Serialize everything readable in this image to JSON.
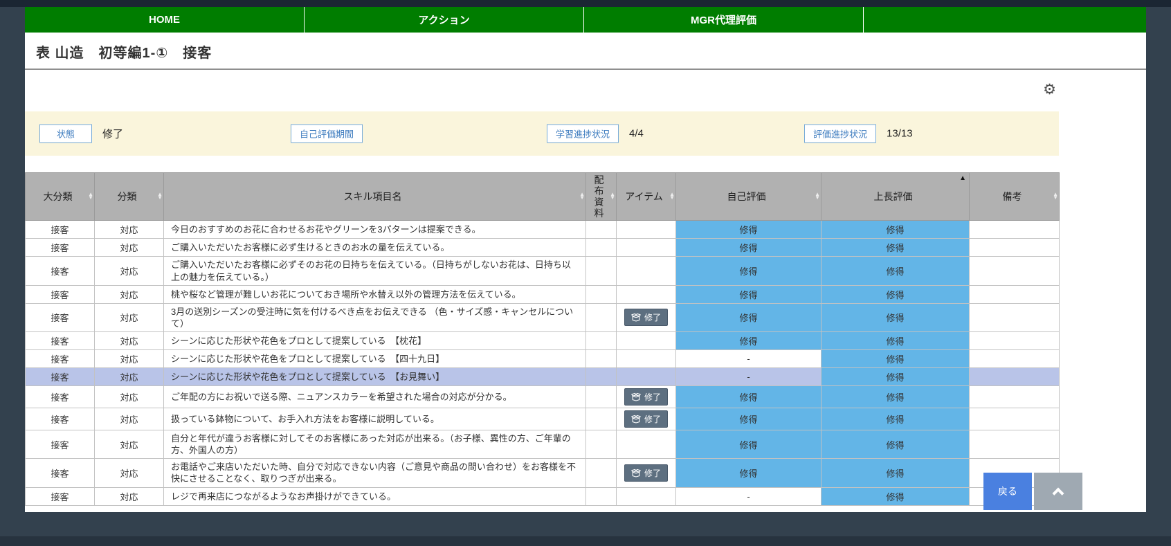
{
  "nav": {
    "items": [
      {
        "key": "home",
        "label": "HOME"
      },
      {
        "key": "action",
        "label": "アクション"
      },
      {
        "key": "mgr-proxy-eval",
        "label": "MGR代理評価"
      }
    ]
  },
  "page": {
    "title": "表 山造　初等編1-①　接客"
  },
  "icons": {
    "gear": "⚙"
  },
  "status_bar": {
    "status_label": "状態",
    "status_value": "修了",
    "self_eval_period_label": "自己評価期間",
    "learning_progress_label": "学習進捗状況",
    "learning_progress_value": "4/4",
    "eval_progress_label": "評価進捗状況",
    "eval_progress_value": "13/13"
  },
  "table": {
    "learned_text": "修得",
    "item_button_label": "修了",
    "headers": [
      {
        "label": "大分類",
        "sort": "both"
      },
      {
        "label": "分類",
        "sort": "both"
      },
      {
        "label": "スキル項目名",
        "sort": "both"
      },
      {
        "label": "配布資料",
        "sort": "both"
      },
      {
        "label": "アイテム",
        "sort": "both"
      },
      {
        "label": "自己評価",
        "sort": "both"
      },
      {
        "label": "上長評価",
        "sort": "asc"
      },
      {
        "label": "備考",
        "sort": "both"
      }
    ],
    "rows": [
      {
        "major": "接客",
        "category": "対応",
        "skill": "今日のおすすめのお花に合わせるお花やグリーンを3パターンは提案できる。",
        "handout": "",
        "item": false,
        "self_eval": "修得",
        "manager_eval": "修得",
        "remarks": "",
        "highlighted": false
      },
      {
        "major": "接客",
        "category": "対応",
        "skill": "ご購入いただいたお客様に必ず生けるときのお水の量を伝えている。",
        "handout": "",
        "item": false,
        "self_eval": "修得",
        "manager_eval": "修得",
        "remarks": "",
        "highlighted": false
      },
      {
        "major": "接客",
        "category": "対応",
        "skill": "ご購入いただいたお客様に必ずそのお花の日持ちを伝えている。（日持ちがしないお花は、日持ち以上の魅力を伝えている。）",
        "handout": "",
        "item": false,
        "self_eval": "修得",
        "manager_eval": "修得",
        "remarks": "",
        "highlighted": false
      },
      {
        "major": "接客",
        "category": "対応",
        "skill": "桃や桜など管理が難しいお花についておき場所や水替え以外の管理方法を伝えている。",
        "handout": "",
        "item": false,
        "self_eval": "修得",
        "manager_eval": "修得",
        "remarks": "",
        "highlighted": false
      },
      {
        "major": "接客",
        "category": "対応",
        "skill": "3月の送別シーズンの受注時に気を付けるべき点をお伝えできる （色・サイズ感・キャンセルについて）",
        "handout": "",
        "item": true,
        "self_eval": "修得",
        "manager_eval": "修得",
        "remarks": "",
        "highlighted": false
      },
      {
        "major": "接客",
        "category": "対応",
        "skill": "シーンに応じた形状や花色をプロとして提案している　【枕花】",
        "handout": "",
        "item": false,
        "self_eval": "修得",
        "manager_eval": "修得",
        "remarks": "",
        "highlighted": false
      },
      {
        "major": "接客",
        "category": "対応",
        "skill": "シーンに応じた形状や花色をプロとして提案している　【四十九日】",
        "handout": "",
        "item": false,
        "self_eval": "-",
        "manager_eval": "修得",
        "remarks": "",
        "highlighted": false
      },
      {
        "major": "接客",
        "category": "対応",
        "skill": "シーンに応じた形状や花色をプロとして提案している　【お見舞い】",
        "handout": "",
        "item": false,
        "self_eval": "-",
        "manager_eval": "修得",
        "remarks": "",
        "highlighted": true
      },
      {
        "major": "接客",
        "category": "対応",
        "skill": "ご年配の方にお祝いで送る際、ニュアンスカラーを希望された場合の対応が分かる。",
        "handout": "",
        "item": true,
        "self_eval": "修得",
        "manager_eval": "修得",
        "remarks": "",
        "highlighted": false
      },
      {
        "major": "接客",
        "category": "対応",
        "skill": "扱っている鉢物について、お手入れ方法をお客様に説明している。",
        "handout": "",
        "item": true,
        "self_eval": "修得",
        "manager_eval": "修得",
        "remarks": "",
        "highlighted": false
      },
      {
        "major": "接客",
        "category": "対応",
        "skill": "自分と年代が違うお客様に対してそのお客様にあった対応が出来る。（お子様、異性の方、ご年輩の方、外国人の方）",
        "handout": "",
        "item": false,
        "self_eval": "修得",
        "manager_eval": "修得",
        "remarks": "",
        "highlighted": false
      },
      {
        "major": "接客",
        "category": "対応",
        "skill": "お電話やご来店いただいた時、自分で対応できない内容（ご意見や商品の問い合わせ）をお客様を不快にさせることなく、取りつぎが出来る。",
        "handout": "",
        "item": true,
        "self_eval": "修得",
        "manager_eval": "修得",
        "remarks": "",
        "highlighted": false
      },
      {
        "major": "接客",
        "category": "対応",
        "skill": "レジで再来店につながるようなお声掛けができている。",
        "handout": "",
        "item": false,
        "self_eval": "-",
        "manager_eval": "修得",
        "remarks": "",
        "highlighted": false
      }
    ]
  },
  "footer": {
    "back_button": "戻る"
  },
  "colors": {
    "nav_green": "#007d00",
    "status_bar_bg": "#faf5dc",
    "eval_learned_blue": "#63b5e7",
    "highlight_row": "#b9c4e8",
    "item_button_bg": "#5d6f80",
    "back_button_blue": "#4a80e0",
    "scroll_top_gray": "#9fa9b2",
    "header_gray": "#b1b1b1"
  }
}
